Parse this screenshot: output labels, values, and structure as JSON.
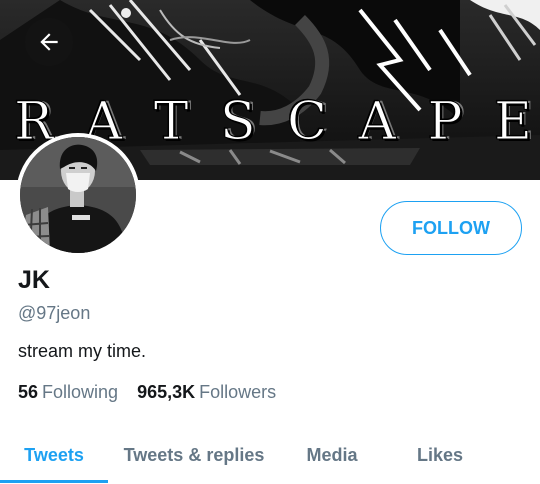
{
  "banner": {
    "letters": [
      "R",
      "A",
      "T",
      "S",
      "C",
      "A",
      "P",
      "E"
    ]
  },
  "profile": {
    "display_name": "JK",
    "handle": "@97jeon",
    "bio": "stream my time.",
    "follow_label": "FOLLOW"
  },
  "stats": {
    "following_count": "56",
    "following_label": "Following",
    "followers_count": "965,3K",
    "followers_label": "Followers"
  },
  "tabs": [
    {
      "label": "Tweets",
      "active": true
    },
    {
      "label": "Tweets & replies",
      "active": false
    },
    {
      "label": "Media",
      "active": false
    },
    {
      "label": "Likes",
      "active": false
    }
  ],
  "colors": {
    "accent": "#1da1f2",
    "secondary_text": "#657786",
    "primary_text": "#14171a"
  },
  "icons": {
    "back": "arrow-left-icon"
  }
}
